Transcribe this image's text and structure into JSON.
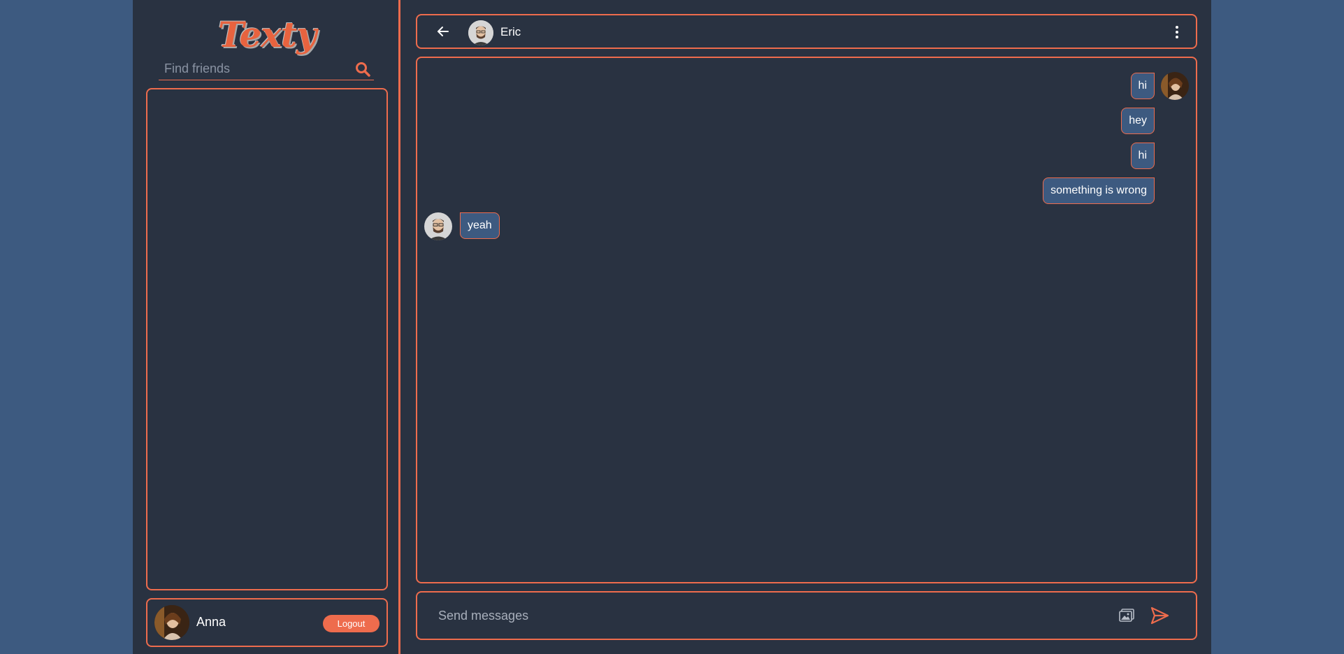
{
  "sidebar": {
    "logo": "Texty",
    "search": {
      "placeholder": "Find friends",
      "value": ""
    },
    "user": {
      "name": "Anna",
      "logout_label": "Logout"
    }
  },
  "chat": {
    "contact_name": "Eric",
    "messages": [
      {
        "text": "hi",
        "from": "me"
      },
      {
        "text": "hey",
        "from": "me"
      },
      {
        "text": "hi",
        "from": "me"
      },
      {
        "text": "something is wrong",
        "from": "me"
      },
      {
        "text": "yeah",
        "from": "contact"
      }
    ],
    "composer": {
      "placeholder": "Send messages",
      "value": ""
    }
  },
  "colors": {
    "background": "#3d5a80",
    "panel": "#293241",
    "accent": "#ee6c4d",
    "bubble": "#3d5a80"
  },
  "icons": [
    "search-icon",
    "back-arrow-icon",
    "more-vertical-icon",
    "image-icon",
    "send-icon"
  ]
}
